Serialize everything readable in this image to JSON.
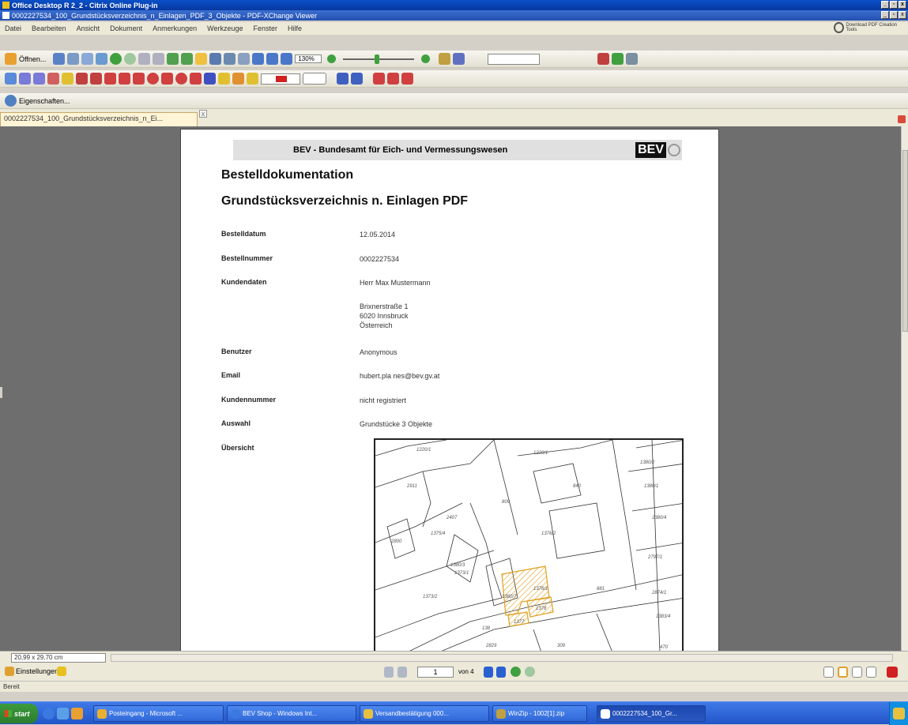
{
  "window": {
    "outer_title": "Office Desktop R 2_2 - Citrix Online Plug-in",
    "inner_title": "0002227534_100_Grundstücksverzeichnis_n_Einlagen_PDF_3_Objekte - PDF-XChange Viewer"
  },
  "menu": [
    "Datei",
    "Bearbeiten",
    "Ansicht",
    "Dokument",
    "Anmerkungen",
    "Werkzeuge",
    "Fenster",
    "Hilfe"
  ],
  "toolbar": {
    "open_label": "Öffnen...",
    "zoom_value": "130%",
    "properties_label": "Eigenschaften...",
    "download_label": "Download PDF Creation Tools"
  },
  "tab": {
    "label": "0002227534_100_Grundstücksverzeichnis_n_Ei..."
  },
  "document": {
    "header_text": "BEV - Bundesamt für Eich- und Vermessungswesen",
    "logo_text": "BEV",
    "title1": "Bestelldokumentation",
    "title2": "Grundstücksverzeichnis n. Einlagen PDF",
    "fields": [
      {
        "label": "Bestelldatum",
        "value": "12.05.2014"
      },
      {
        "label": "Bestellnummer",
        "value": "0002227534"
      },
      {
        "label": "Kundendaten",
        "value": "Herr Max Mustermann"
      },
      {
        "label": "",
        "value": "Brixnerstraße 1"
      },
      {
        "label": "",
        "value": "6020 Innsbruck"
      },
      {
        "label": "",
        "value": "Österreich"
      },
      {
        "label": "Benutzer",
        "value": "Anonymous"
      },
      {
        "label": "Email",
        "value": "hubert.pla nes@bev.gv.at"
      },
      {
        "label": "Kundennummer",
        "value": "nicht registriert"
      },
      {
        "label": "Auswahl",
        "value": "Grundstücke 3 Objekte"
      },
      {
        "label": "Übersicht",
        "value": ""
      }
    ],
    "map_labels": [
      "1220/1",
      "1220/1",
      "2911",
      "840",
      "1380/2",
      "1380/1",
      "809",
      "1380/4",
      "2407",
      "1375/4",
      "1376/2",
      "2800",
      "2797/1",
      "1380/3",
      "1373/1",
      "1380/7",
      "1373/2",
      "1376/1",
      "1378",
      "1377",
      "881",
      "2874/1",
      "1383/4",
      "138",
      "2829",
      "309",
      "470"
    ]
  },
  "status": {
    "page_size": "20,99 x 29,70 cm",
    "page_current": "1",
    "page_total": "von 4",
    "settings_label": "Einstellungen",
    "ready": "Bereit"
  },
  "taskbar": {
    "start": "start",
    "items": [
      "Posteingang - Microsoft ...",
      "BEV Shop - Windows Int...",
      "Versandbestätigung 000...",
      "WinZip - 1002[1].zip",
      "0002227534_100_Gr..."
    ]
  },
  "colors": {
    "titlebar": "#0a50c8",
    "highlight_parcel": "#f2c34d",
    "doc_background": "#6e6e6e"
  }
}
